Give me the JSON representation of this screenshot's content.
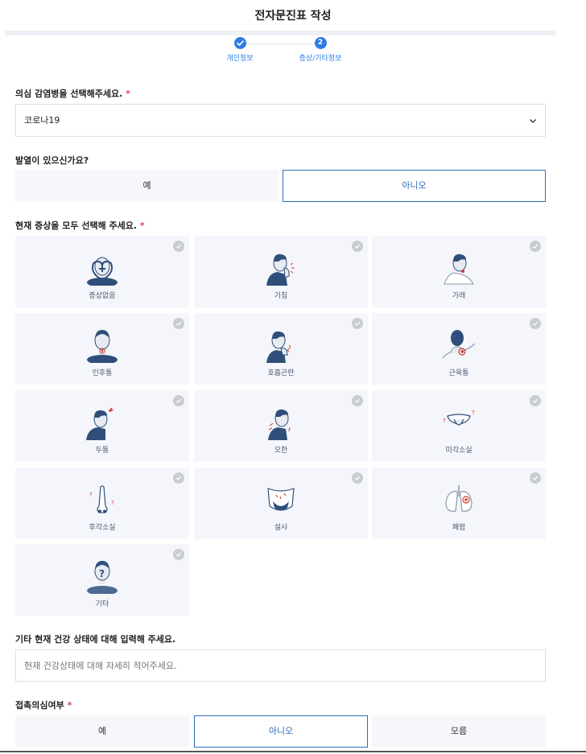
{
  "header": {
    "title": "전자문진표 작성"
  },
  "stepper": {
    "steps": [
      {
        "num": "",
        "label": "개인정보",
        "state": "done"
      },
      {
        "num": "2",
        "label": "증상/기타정보",
        "state": "current"
      }
    ]
  },
  "disease": {
    "question": "의심 감염병을 선택해주세요.",
    "required_mark": "*",
    "selected": "코로나19"
  },
  "fever": {
    "question": "발열이 있으신가요?",
    "options": [
      "예",
      "아니오"
    ],
    "selected": "아니오"
  },
  "symptoms": {
    "question": "현재 증상을 모두 선택해 주세요.",
    "required_mark": "*",
    "items": [
      {
        "label": "증상없음",
        "icon": "heart-face-icon"
      },
      {
        "label": "기침",
        "icon": "cough-icon"
      },
      {
        "label": "가래",
        "icon": "phlegm-icon"
      },
      {
        "label": "인후통",
        "icon": "sore-throat-icon"
      },
      {
        "label": "호흡곤란",
        "icon": "breathing-icon"
      },
      {
        "label": "근육통",
        "icon": "muscle-pain-icon"
      },
      {
        "label": "두통",
        "icon": "headache-icon"
      },
      {
        "label": "오한",
        "icon": "chills-icon"
      },
      {
        "label": "미각소실",
        "icon": "taste-loss-icon"
      },
      {
        "label": "후각소실",
        "icon": "smell-loss-icon"
      },
      {
        "label": "설사",
        "icon": "diarrhea-icon"
      },
      {
        "label": "폐렴",
        "icon": "lungs-icon"
      },
      {
        "label": "기타",
        "icon": "question-person-icon"
      }
    ]
  },
  "other_health": {
    "question": "기타 현재 건강 상태에 대해 입력해 주세요.",
    "placeholder": "현재 건강상태에 대해 자세히 적어주세요."
  },
  "contact": {
    "question": "접촉의심여부",
    "required_mark": "*",
    "options": [
      "예",
      "아니오",
      "모름"
    ],
    "selected": "아니오"
  },
  "colors": {
    "accent": "#2d7be5",
    "selected_border": "#2d6fb8",
    "required": "#e0414f",
    "card_bg": "#f4f6fb"
  }
}
